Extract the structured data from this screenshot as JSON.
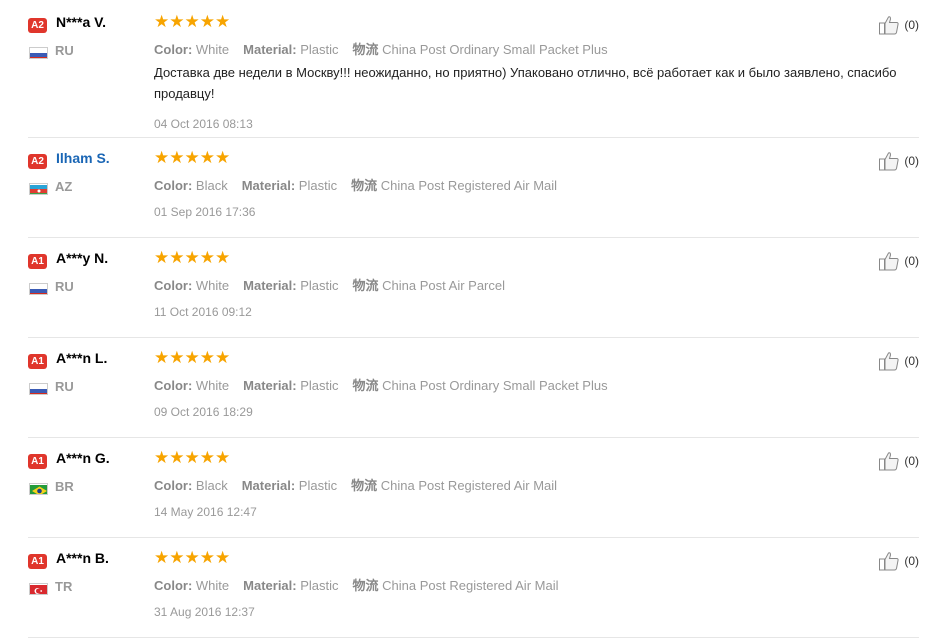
{
  "reviews": [
    {
      "badge": "A2",
      "name": "N***a V.",
      "name_is_link": false,
      "country": "RU",
      "flag": "ru",
      "stars": "★★★★★",
      "attrs": [
        {
          "key": "Color:",
          "value": "White"
        },
        {
          "key": "Material:",
          "value": "Plastic"
        },
        {
          "key": "物流",
          "value": "China Post Ordinary Small Packet Plus"
        }
      ],
      "content": "Доставка две недели в Москву!!! неожиданно, но приятно) Упаковано отлично, всё работает как и было заявлено, спасибо продавцу!",
      "date": "04 Oct 2016 08:13",
      "helpful": "(0)"
    },
    {
      "badge": "A2",
      "name": "Ilham S.",
      "name_is_link": true,
      "country": "AZ",
      "flag": "az",
      "stars": "★★★★★",
      "attrs": [
        {
          "key": "Color:",
          "value": "Black"
        },
        {
          "key": "Material:",
          "value": "Plastic"
        },
        {
          "key": "物流",
          "value": "China Post Registered Air Mail"
        }
      ],
      "content": "",
      "date": "01 Sep 2016 17:36",
      "helpful": "(0)"
    },
    {
      "badge": "A1",
      "name": "A***y N.",
      "name_is_link": false,
      "country": "RU",
      "flag": "ru",
      "stars": "★★★★★",
      "attrs": [
        {
          "key": "Color:",
          "value": "White"
        },
        {
          "key": "Material:",
          "value": "Plastic"
        },
        {
          "key": "物流",
          "value": "China Post Air Parcel"
        }
      ],
      "content": "",
      "date": "11 Oct 2016 09:12",
      "helpful": "(0)"
    },
    {
      "badge": "A1",
      "name": "A***n L.",
      "name_is_link": false,
      "country": "RU",
      "flag": "ru",
      "stars": "★★★★★",
      "attrs": [
        {
          "key": "Color:",
          "value": "White"
        },
        {
          "key": "Material:",
          "value": "Plastic"
        },
        {
          "key": "物流",
          "value": "China Post Ordinary Small Packet Plus"
        }
      ],
      "content": "",
      "date": "09 Oct 2016 18:29",
      "helpful": "(0)"
    },
    {
      "badge": "A1",
      "name": "A***n G.",
      "name_is_link": false,
      "country": "BR",
      "flag": "br",
      "stars": "★★★★★",
      "attrs": [
        {
          "key": "Color:",
          "value": "Black"
        },
        {
          "key": "Material:",
          "value": "Plastic"
        },
        {
          "key": "物流",
          "value": "China Post Registered Air Mail"
        }
      ],
      "content": "",
      "date": "14 May 2016 12:47",
      "helpful": "(0)"
    },
    {
      "badge": "A1",
      "name": "A***n B.",
      "name_is_link": false,
      "country": "TR",
      "flag": "tr",
      "stars": "★★★★★",
      "attrs": [
        {
          "key": "Color:",
          "value": "White"
        },
        {
          "key": "Material:",
          "value": "Plastic"
        },
        {
          "key": "物流",
          "value": "China Post Registered Air Mail"
        }
      ],
      "content": "",
      "date": "31 Aug 2016 12:37",
      "helpful": "(0)"
    }
  ],
  "colors": {
    "badge": "#e0362c",
    "star": "#f7a400",
    "link": "#1a66b5"
  }
}
